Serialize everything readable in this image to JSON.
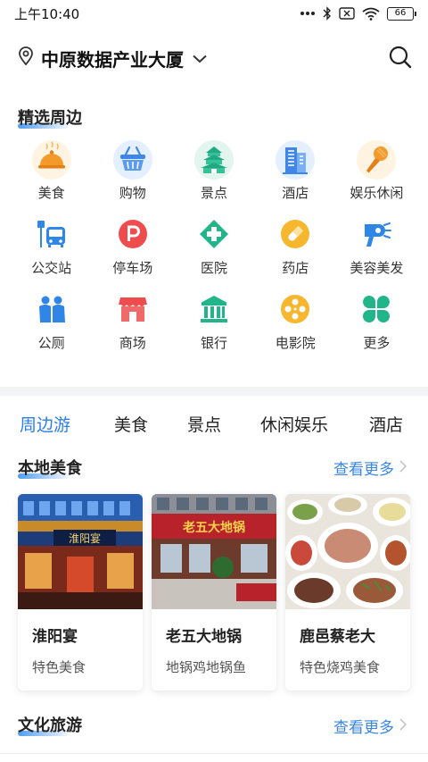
{
  "status_bar": {
    "time": "上午10:40",
    "battery": "66"
  },
  "location": {
    "name": "中原数据产业大厦"
  },
  "nearby": {
    "title": "精选周边",
    "items": [
      {
        "label": "美食",
        "icon": "food-cloche-icon"
      },
      {
        "label": "购物",
        "icon": "shopping-basket-icon"
      },
      {
        "label": "景点",
        "icon": "temple-icon"
      },
      {
        "label": "酒店",
        "icon": "hotel-building-icon"
      },
      {
        "label": "娱乐休闲",
        "icon": "microphone-icon"
      },
      {
        "label": "公交站",
        "icon": "bus-stop-icon"
      },
      {
        "label": "停车场",
        "icon": "parking-icon"
      },
      {
        "label": "医院",
        "icon": "hospital-cross-icon"
      },
      {
        "label": "药店",
        "icon": "pill-icon"
      },
      {
        "label": "美容美发",
        "icon": "hair-dryer-icon"
      },
      {
        "label": "公厕",
        "icon": "toilet-icon"
      },
      {
        "label": "商场",
        "icon": "mall-icon"
      },
      {
        "label": "银行",
        "icon": "bank-icon"
      },
      {
        "label": "电影院",
        "icon": "film-reel-icon"
      },
      {
        "label": "更多",
        "icon": "more-grid-icon"
      }
    ]
  },
  "tabs": [
    "周边游",
    "美食",
    "景点",
    "休闲娱乐",
    "酒店"
  ],
  "local_food": {
    "title": "本地美食",
    "more": "查看更多",
    "cards": [
      {
        "name": "淮阳宴",
        "sub": "特色美食",
        "sign": "淮阳宴"
      },
      {
        "name": "老五大地锅",
        "sub": "地锅鸡地锅鱼",
        "sign": "老五大地锅"
      },
      {
        "name": "鹿邑蔡老大",
        "sub": "特色烧鸡美食"
      }
    ]
  },
  "culture_travel": {
    "title": "文化旅游",
    "more": "查看更多"
  },
  "colors": {
    "accent": "#2b7de9",
    "link": "#3a86e8"
  }
}
